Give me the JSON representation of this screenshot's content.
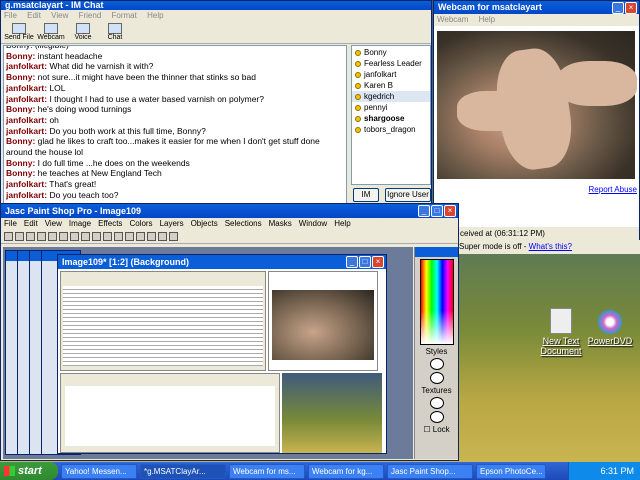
{
  "chat": {
    "title": "g.msatclayart - IM Chat",
    "menu": [
      "File",
      "Edit",
      "View",
      "Friend",
      "Format",
      "Help"
    ],
    "toolbar": [
      "Send File",
      "Webcam",
      "Voice",
      "Chat"
    ],
    "messages": [
      {
        "who": "",
        "text": "Bonny: (illegible)"
      },
      {
        "who": "Bonny:",
        "text": " instant headache"
      },
      {
        "who": "janfolkart:",
        "text": " What did he varnish it with?"
      },
      {
        "who": "Bonny:",
        "text": " not sure...it might have been the thinner that stinks so bad"
      },
      {
        "who": "janfolkart:",
        "text": " LOL"
      },
      {
        "who": "janfolkart:",
        "text": " I thought I had to use a water based varnish on polymer?"
      },
      {
        "who": "Bonny:",
        "text": " he's doing wood turnings"
      },
      {
        "who": "janfolkart:",
        "text": " oh"
      },
      {
        "who": "janfolkart:",
        "text": " Do you both work at this full time, Bonny?"
      },
      {
        "who": "Bonny:",
        "text": " glad he likes to craft too...makes it easier for me when I don't get stuff done around the house lol"
      },
      {
        "who": "Bonny:",
        "text": " I do full time ...he does on the weekends"
      },
      {
        "who": "Bonny:",
        "text": " he teaches at New England Tech"
      },
      {
        "who": "janfolkart:",
        "text": " That's great!"
      },
      {
        "who": "janfolkart:",
        "text": " Do you teach too?"
      }
    ],
    "buddies": [
      "Bonny",
      "Fearless Leader",
      "janfolkart",
      "Karen B",
      "kgedrich",
      "pennyi",
      "shargoose",
      "tobors_dragon"
    ],
    "im_button": "IM",
    "ignore_button": "Ignore User"
  },
  "webcam": {
    "title": "Webcam for msatclayart",
    "menu": [
      "Webcam",
      "Help"
    ],
    "report": "Report Abuse",
    "received": "ceived at (06:31:12 PM)"
  },
  "supermode": {
    "text": "Super mode is off - ",
    "link": "What's this?"
  },
  "psp": {
    "title": "Jasc Paint Shop Pro - Image109",
    "menu": [
      "File",
      "Edit",
      "View",
      "Image",
      "Effects",
      "Colors",
      "Layers",
      "Objects",
      "Selections",
      "Masks",
      "Window",
      "Help"
    ],
    "image_title": "Image109* [1:2] (Background)",
    "palette": {
      "styles": "Styles",
      "textures": "Textures",
      "lock": "Lock"
    }
  },
  "desktop": {
    "icons": [
      "New Text Document",
      "PowerDVD"
    ]
  },
  "taskbar": {
    "start": "start",
    "items": [
      "Yahoo! Messen...",
      "*g.MSATClayAr...",
      "Webcam for ms...",
      "Webcam for kg...",
      "Jasc Paint Shop...",
      "Epson PhotoCe..."
    ],
    "clock": "6:31 PM"
  },
  "colors": {
    "xp_blue": "#0a5fd8",
    "taskbar": "#1d49b7",
    "start_green": "#3c9a3c"
  }
}
